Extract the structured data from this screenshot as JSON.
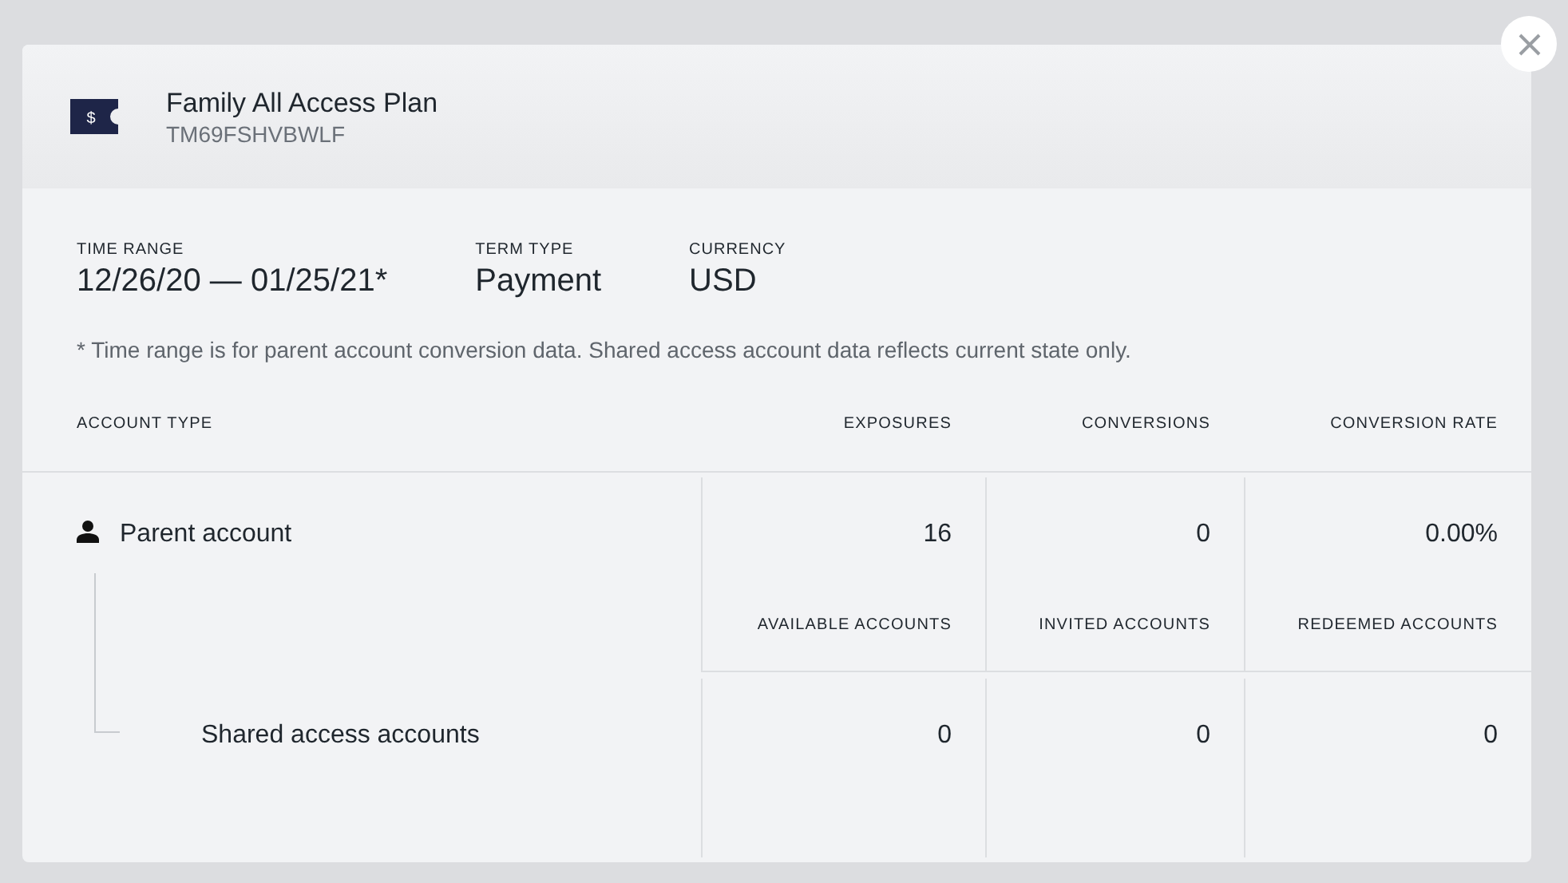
{
  "plan": {
    "icon_glyph": "$",
    "title": "Family All Access Plan",
    "code": "TM69FSHVBWLF"
  },
  "summary": [
    {
      "label": "TIME RANGE",
      "value": "12/26/20 — 01/25/21*"
    },
    {
      "label": "TERM TYPE",
      "value": "Payment"
    },
    {
      "label": "CURRENCY",
      "value": "USD"
    }
  ],
  "note": "* Time range is for parent account conversion data. Shared access account data reflects current state only.",
  "table": {
    "columns": [
      "ACCOUNT TYPE",
      "EXPOSURES",
      "CONVERSIONS",
      "CONVERSION RATE"
    ],
    "rows": [
      {
        "kind": "parent",
        "name": "Parent account",
        "values": [
          "16",
          "0",
          "0.00%"
        ],
        "sublabels": [
          "AVAILABLE ACCOUNTS",
          "INVITED ACCOUNTS",
          "REDEEMED ACCOUNTS"
        ]
      },
      {
        "kind": "child",
        "name": "Shared access accounts",
        "values": [
          "0",
          "0",
          "0"
        ]
      }
    ]
  }
}
